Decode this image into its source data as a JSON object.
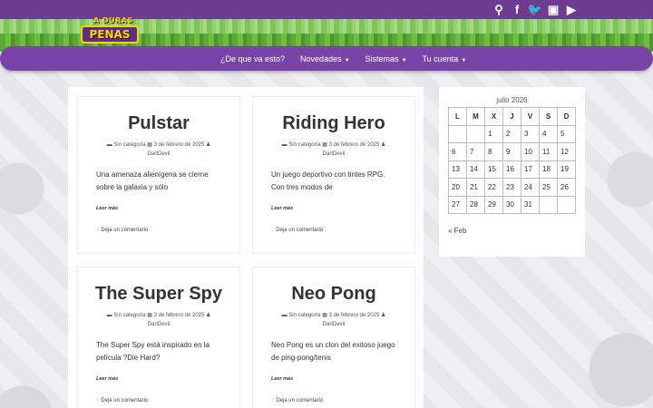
{
  "logo": {
    "top": "A DURAS",
    "bottom": "PENAS"
  },
  "social": [
    "search-icon",
    "facebook-icon",
    "twitter-icon",
    "twitch-icon",
    "youtube-icon"
  ],
  "social_glyphs": [
    "⚲",
    "f",
    "🐦",
    "▣",
    "▶"
  ],
  "nav": {
    "items": [
      {
        "label": "¿De que va esto?",
        "caret": ""
      },
      {
        "label": "Novedades",
        "caret": "▼"
      },
      {
        "label": "Sistemas",
        "caret": "▼"
      },
      {
        "label": "Tu cuenta",
        "caret": "▼"
      }
    ]
  },
  "posts": [
    {
      "title": "Pulstar",
      "category": "Sin categoría",
      "date": "3 de febrero de 2025",
      "author": "DartDevil",
      "excerpt": "Una amenaza alienígena se cierne sobre la galaxia y sólo",
      "readmore": "Leer más",
      "comment": "Deja un comentario"
    },
    {
      "title": "Riding Hero",
      "category": "Sin categoría",
      "date": "3 de febrero de 2025",
      "author": "DartDevil",
      "excerpt": "Un juego deportivo con tintes RPG. Con tres modos de",
      "readmore": "Leer más",
      "comment": "Deja un comentario"
    },
    {
      "title": "The Super Spy",
      "category": "Sin categoría",
      "date": "3 de febrero de 2025",
      "author": "DartDevil",
      "excerpt": "The Super Spy está inspirado en la película ?Die Hard?",
      "readmore": "Leer más",
      "comment": "Deja un comentario"
    },
    {
      "title": "Neo Pong",
      "category": "Sin categoría",
      "date": "3 de febrero de 2025",
      "author": "DartDevil",
      "excerpt": "Neo Pong es un clon del exitoso juego de ping-pong/tenis",
      "readmore": "Leer más",
      "comment": "Deja un comentario"
    }
  ],
  "calendar": {
    "caption": "julio 2026",
    "headers": [
      "L",
      "M",
      "X",
      "J",
      "V",
      "S",
      "D"
    ],
    "rows": [
      [
        "",
        "",
        "1",
        "2",
        "3",
        "4",
        "5"
      ],
      [
        "6",
        "7",
        "8",
        "9",
        "10",
        "11",
        "12"
      ],
      [
        "13",
        "14",
        "15",
        "16",
        "17",
        "18",
        "19"
      ],
      [
        "20",
        "21",
        "22",
        "23",
        "24",
        "25",
        "26"
      ],
      [
        "27",
        "28",
        "29",
        "30",
        "31",
        "",
        ""
      ]
    ],
    "prev": "« Feb"
  },
  "icons": {
    "folder": "▬",
    "calendar": "▦",
    "user": "♟",
    "comment": "◌"
  }
}
